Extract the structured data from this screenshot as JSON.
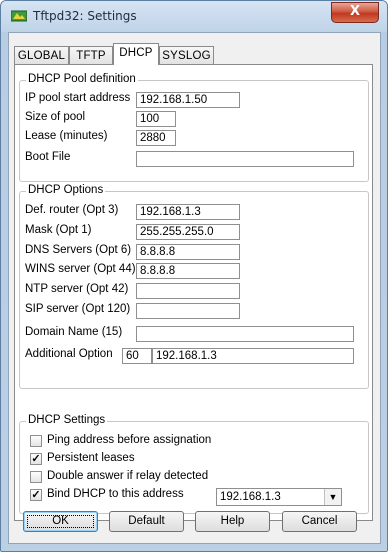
{
  "window": {
    "title": "Tftpd32: Settings",
    "close_glyph": "X",
    "icon": "tftpd32-app-icon"
  },
  "tabs": [
    {
      "label": "GLOBAL"
    },
    {
      "label": "TFTP"
    },
    {
      "label": "DHCP",
      "active": true
    },
    {
      "label": "SYSLOG"
    }
  ],
  "pool": {
    "title": "DHCP Pool definition",
    "start_label": "IP pool start address",
    "start_value": "192.168.1.50",
    "size_label": "Size of pool",
    "size_value": "100",
    "lease_label": "Lease (minutes)",
    "lease_value": "2880",
    "boot_label": "Boot File",
    "boot_value": ""
  },
  "options": {
    "title": "DHCP Options",
    "router_label": "Def. router (Opt 3)",
    "router_value": "192.168.1.3",
    "mask_label": "Mask (Opt 1)",
    "mask_value": "255.255.255.0",
    "dns_label": "DNS Servers (Opt 6)",
    "dns_value": "8.8.8.8",
    "wins_label": "WINS server (Opt 44)",
    "wins_value": "8.8.8.8",
    "ntp_label": "NTP server (Opt 42)",
    "ntp_value": "",
    "sip_label": "SIP server (Opt 120)",
    "sip_value": "",
    "domain_label": "Domain Name (15)",
    "domain_value": "",
    "additional_label": "Additional Option",
    "additional_code": "60",
    "additional_value": "192.168.1.3"
  },
  "settings": {
    "title": "DHCP Settings",
    "check_mark": "✓",
    "ping_label": "Ping address before assignation",
    "ping_checked": false,
    "persistent_label": "Persistent leases",
    "persistent_checked": true,
    "double_label": "Double answer if relay detected",
    "double_checked": false,
    "bind_label": "Bind DHCP to this address",
    "bind_checked": true,
    "bind_address": "192.168.1.3",
    "dropdown_glyph": "▼"
  },
  "buttons": {
    "ok": "OK",
    "default": "Default",
    "help": "Help",
    "cancel": "Cancel"
  }
}
